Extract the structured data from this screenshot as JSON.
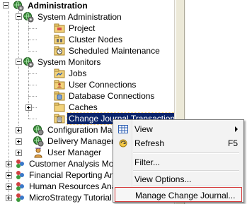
{
  "tree": {
    "items": [
      {
        "label": "Administration",
        "icon": "globe-gear-icon"
      },
      {
        "label": "System Administration",
        "icon": "globe-gear-icon"
      },
      {
        "label": "Project",
        "icon": "project-folder-icon"
      },
      {
        "label": "Cluster Nodes",
        "icon": "cluster-nodes-icon"
      },
      {
        "label": "Scheduled Maintenance",
        "icon": "schedule-icon"
      },
      {
        "label": "System Monitors",
        "icon": "globe-gear-icon"
      },
      {
        "label": "Jobs",
        "icon": "jobs-icon"
      },
      {
        "label": "User Connections",
        "icon": "user-connections-icon"
      },
      {
        "label": "Database Connections",
        "icon": "database-connections-icon"
      },
      {
        "label": "Caches",
        "icon": "caches-folder-icon"
      },
      {
        "label": "Change Journal Transactions",
        "icon": "change-journal-icon"
      },
      {
        "label": "Configuration Managers",
        "icon": "globe-gear-icon"
      },
      {
        "label": "Delivery Managers",
        "icon": "globe-gear-icon"
      },
      {
        "label": "User Manager",
        "icon": "user-manager-icon"
      },
      {
        "label": "Customer Analysis Module",
        "icon": "project-icon"
      },
      {
        "label": "Financial Reporting Analysis",
        "icon": "project-icon"
      },
      {
        "label": "Human Resources Analysis",
        "icon": "project-icon"
      },
      {
        "label": "MicroStrategy Tutorial",
        "icon": "project-icon"
      }
    ]
  },
  "context_menu": {
    "items": [
      {
        "label": "View",
        "icon": "view-grid-icon",
        "shortcut": "",
        "submenu": true
      },
      {
        "label": "Refresh",
        "icon": "refresh-icon",
        "shortcut": "F5",
        "submenu": false
      },
      {
        "label": "Filter...",
        "icon": "",
        "shortcut": "",
        "submenu": false
      },
      {
        "label": "View Options...",
        "icon": "",
        "shortcut": "",
        "submenu": false
      },
      {
        "label": "Manage Change Journal...",
        "icon": "",
        "shortcut": "",
        "submenu": false
      }
    ]
  },
  "colors": {
    "selection": "#0a246a",
    "highlight_box": "#d53c3c",
    "menu_bg": "#f3f3f3"
  }
}
